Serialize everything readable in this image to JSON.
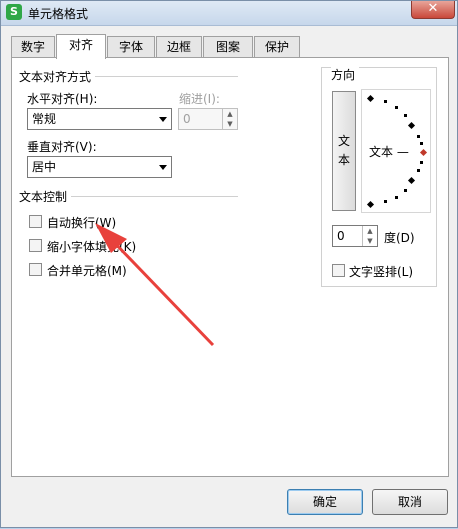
{
  "window": {
    "title": "单元格格式",
    "app_icon": "S",
    "close_glyph": "✕"
  },
  "tabs": [
    {
      "label": "数字"
    },
    {
      "label": "对齐"
    },
    {
      "label": "字体"
    },
    {
      "label": "边框"
    },
    {
      "label": "图案"
    },
    {
      "label": "保护"
    }
  ],
  "active_tab": "对齐",
  "alignment": {
    "group_title": "文本对齐方式",
    "horizontal": {
      "label": "水平对齐(H):",
      "value": "常规"
    },
    "indent": {
      "label": "缩进(I):",
      "value": "0"
    },
    "vertical": {
      "label": "垂直对齐(V):",
      "value": "居中"
    }
  },
  "text_control": {
    "group_title": "文本控制",
    "wrap_text": "自动换行(W)",
    "shrink_to_fit": "缩小字体填充(K)",
    "merge_cells": "合并单元格(M)"
  },
  "orientation": {
    "group_title": "方向",
    "vertical_text_button": "文本",
    "dial_text": "文本 —",
    "degrees_value": "0",
    "degrees_label": "度(D)",
    "vertical_text_checkbox": "文字竖排(L)"
  },
  "footer": {
    "ok_label": "确定",
    "cancel_label": "取消"
  },
  "colors": {
    "arrow": "#e8413c",
    "dial_marker": "#c0392b",
    "accent": "#3c7fb1"
  }
}
